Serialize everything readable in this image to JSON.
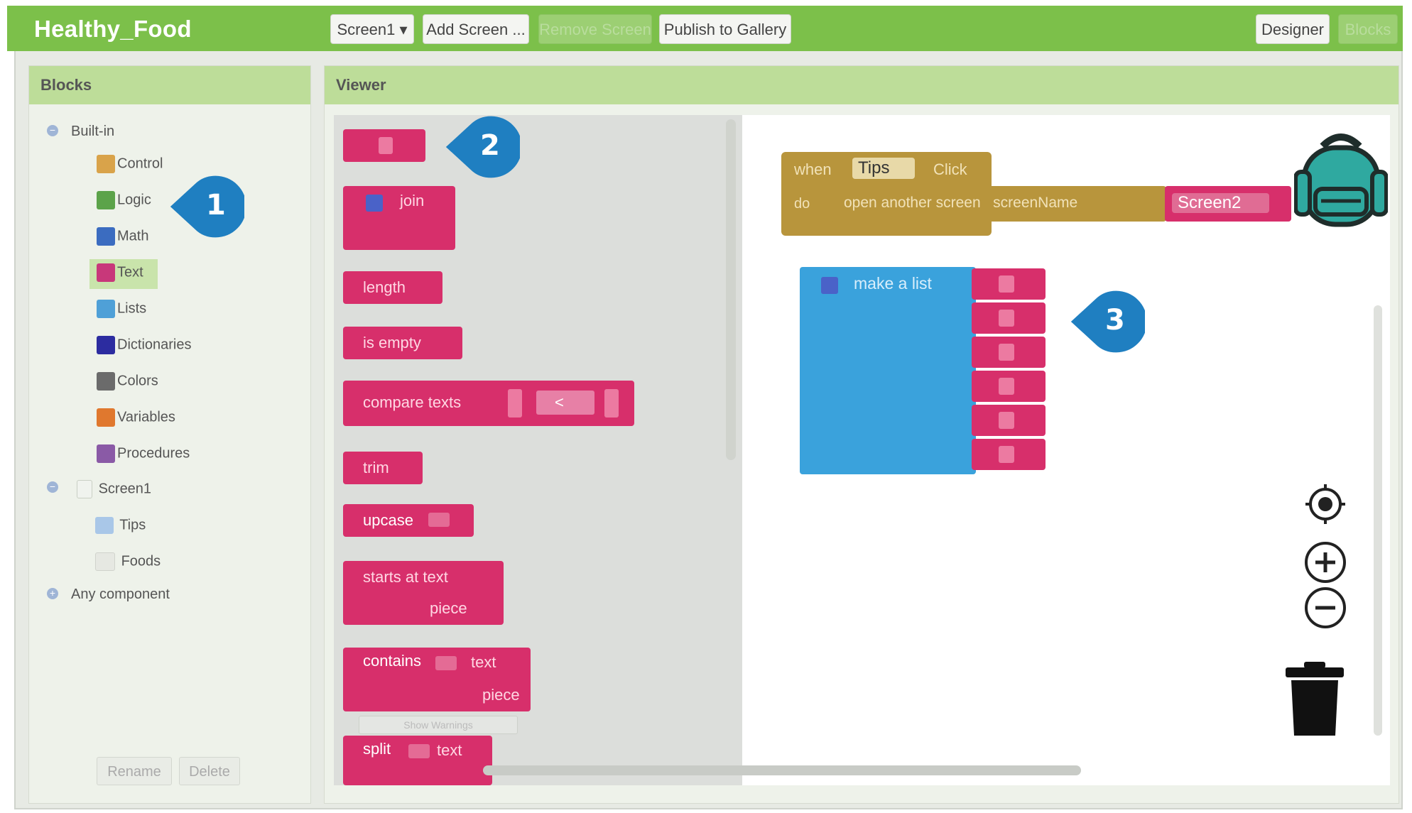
{
  "header": {
    "app_title": "Healthy_Food",
    "screen_dropdown": "Screen1 ▾",
    "add_screen": "Add Screen ...",
    "remove_screen": "Remove Screen",
    "publish": "Publish to Gallery",
    "designer": "Designer",
    "blocks": "Blocks"
  },
  "blocks_panel": {
    "title": "Blocks",
    "builtin_label": "Built-in",
    "builtin_items": [
      {
        "label": "Control",
        "color": "#d9a34a"
      },
      {
        "label": "Logic",
        "color": "#5ca34a"
      },
      {
        "label": "Math",
        "color": "#3b6cc0"
      },
      {
        "label": "Text",
        "color": "#c8387a"
      },
      {
        "label": "Lists",
        "color": "#4fa0d7"
      },
      {
        "label": "Dictionaries",
        "color": "#2c2ca0"
      },
      {
        "label": "Colors",
        "color": "#6b6b6b"
      },
      {
        "label": "Variables",
        "color": "#e0782e"
      },
      {
        "label": "Procedures",
        "color": "#8a5aa6"
      }
    ],
    "screen_label": "Screen1",
    "components": [
      "Tips",
      "Foods"
    ],
    "any_component": "Any component",
    "rename": "Rename",
    "delete": "Delete"
  },
  "viewer": {
    "title": "Viewer",
    "drawer_blocks": {
      "join": "join",
      "length": "length",
      "is_empty": "is empty",
      "compare_texts": "compare texts",
      "compare_op": "<",
      "trim": "trim",
      "upcase": "upcase",
      "starts_at": "starts at  text",
      "piece": "piece",
      "contains": "contains",
      "contains_text": "text",
      "contains_piece": "piece",
      "split": "split",
      "split_text": "text",
      "show_warnings": "Show Warnings"
    },
    "event_block": {
      "when": "when",
      "component": "Tips",
      "event": "Click",
      "do": "do",
      "action": "open another screen   screenName",
      "value": "Screen2"
    },
    "list_block": {
      "label": "make a list",
      "item_count": 6
    }
  },
  "callouts": [
    "1",
    "2",
    "3"
  ],
  "colors": {
    "topbar": "#7cc04a",
    "text_block": "#d72f6b",
    "list_block": "#3aa2dc",
    "event_block": "#b8953c",
    "callout": "#1f7fc1"
  }
}
